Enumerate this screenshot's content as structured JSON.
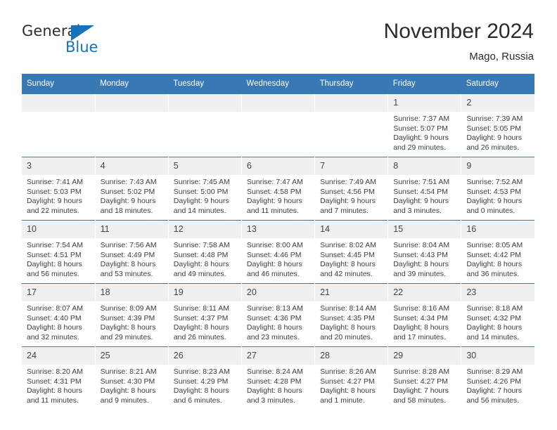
{
  "brand": {
    "name_part1": "General",
    "name_part2": "Blue",
    "accent_color": "#1672bb"
  },
  "header": {
    "title": "November 2024",
    "subtitle": "Mago, Russia"
  },
  "theme": {
    "header_bg": "#3878b5",
    "daynum_bg": "#f0f0f0",
    "text": "#3d3d3d"
  },
  "calendar": {
    "weekday_headers": [
      "Sunday",
      "Monday",
      "Tuesday",
      "Wednesday",
      "Thursday",
      "Friday",
      "Saturday"
    ],
    "weeks": [
      [
        {
          "day": "",
          "empty": true
        },
        {
          "day": "",
          "empty": true
        },
        {
          "day": "",
          "empty": true
        },
        {
          "day": "",
          "empty": true
        },
        {
          "day": "",
          "empty": true
        },
        {
          "day": "1",
          "sunrise": "Sunrise: 7:37 AM",
          "sunset": "Sunset: 5:07 PM",
          "daylight": "Daylight: 9 hours and 29 minutes."
        },
        {
          "day": "2",
          "sunrise": "Sunrise: 7:39 AM",
          "sunset": "Sunset: 5:05 PM",
          "daylight": "Daylight: 9 hours and 26 minutes."
        }
      ],
      [
        {
          "day": "3",
          "sunrise": "Sunrise: 7:41 AM",
          "sunset": "Sunset: 5:03 PM",
          "daylight": "Daylight: 9 hours and 22 minutes."
        },
        {
          "day": "4",
          "sunrise": "Sunrise: 7:43 AM",
          "sunset": "Sunset: 5:02 PM",
          "daylight": "Daylight: 9 hours and 18 minutes."
        },
        {
          "day": "5",
          "sunrise": "Sunrise: 7:45 AM",
          "sunset": "Sunset: 5:00 PM",
          "daylight": "Daylight: 9 hours and 14 minutes."
        },
        {
          "day": "6",
          "sunrise": "Sunrise: 7:47 AM",
          "sunset": "Sunset: 4:58 PM",
          "daylight": "Daylight: 9 hours and 11 minutes."
        },
        {
          "day": "7",
          "sunrise": "Sunrise: 7:49 AM",
          "sunset": "Sunset: 4:56 PM",
          "daylight": "Daylight: 9 hours and 7 minutes."
        },
        {
          "day": "8",
          "sunrise": "Sunrise: 7:51 AM",
          "sunset": "Sunset: 4:54 PM",
          "daylight": "Daylight: 9 hours and 3 minutes."
        },
        {
          "day": "9",
          "sunrise": "Sunrise: 7:52 AM",
          "sunset": "Sunset: 4:53 PM",
          "daylight": "Daylight: 9 hours and 0 minutes."
        }
      ],
      [
        {
          "day": "10",
          "sunrise": "Sunrise: 7:54 AM",
          "sunset": "Sunset: 4:51 PM",
          "daylight": "Daylight: 8 hours and 56 minutes."
        },
        {
          "day": "11",
          "sunrise": "Sunrise: 7:56 AM",
          "sunset": "Sunset: 4:49 PM",
          "daylight": "Daylight: 8 hours and 53 minutes."
        },
        {
          "day": "12",
          "sunrise": "Sunrise: 7:58 AM",
          "sunset": "Sunset: 4:48 PM",
          "daylight": "Daylight: 8 hours and 49 minutes."
        },
        {
          "day": "13",
          "sunrise": "Sunrise: 8:00 AM",
          "sunset": "Sunset: 4:46 PM",
          "daylight": "Daylight: 8 hours and 46 minutes."
        },
        {
          "day": "14",
          "sunrise": "Sunrise: 8:02 AM",
          "sunset": "Sunset: 4:45 PM",
          "daylight": "Daylight: 8 hours and 42 minutes."
        },
        {
          "day": "15",
          "sunrise": "Sunrise: 8:04 AM",
          "sunset": "Sunset: 4:43 PM",
          "daylight": "Daylight: 8 hours and 39 minutes."
        },
        {
          "day": "16",
          "sunrise": "Sunrise: 8:05 AM",
          "sunset": "Sunset: 4:42 PM",
          "daylight": "Daylight: 8 hours and 36 minutes."
        }
      ],
      [
        {
          "day": "17",
          "sunrise": "Sunrise: 8:07 AM",
          "sunset": "Sunset: 4:40 PM",
          "daylight": "Daylight: 8 hours and 32 minutes."
        },
        {
          "day": "18",
          "sunrise": "Sunrise: 8:09 AM",
          "sunset": "Sunset: 4:39 PM",
          "daylight": "Daylight: 8 hours and 29 minutes."
        },
        {
          "day": "19",
          "sunrise": "Sunrise: 8:11 AM",
          "sunset": "Sunset: 4:37 PM",
          "daylight": "Daylight: 8 hours and 26 minutes."
        },
        {
          "day": "20",
          "sunrise": "Sunrise: 8:13 AM",
          "sunset": "Sunset: 4:36 PM",
          "daylight": "Daylight: 8 hours and 23 minutes."
        },
        {
          "day": "21",
          "sunrise": "Sunrise: 8:14 AM",
          "sunset": "Sunset: 4:35 PM",
          "daylight": "Daylight: 8 hours and 20 minutes."
        },
        {
          "day": "22",
          "sunrise": "Sunrise: 8:16 AM",
          "sunset": "Sunset: 4:34 PM",
          "daylight": "Daylight: 8 hours and 17 minutes."
        },
        {
          "day": "23",
          "sunrise": "Sunrise: 8:18 AM",
          "sunset": "Sunset: 4:32 PM",
          "daylight": "Daylight: 8 hours and 14 minutes."
        }
      ],
      [
        {
          "day": "24",
          "sunrise": "Sunrise: 8:20 AM",
          "sunset": "Sunset: 4:31 PM",
          "daylight": "Daylight: 8 hours and 11 minutes."
        },
        {
          "day": "25",
          "sunrise": "Sunrise: 8:21 AM",
          "sunset": "Sunset: 4:30 PM",
          "daylight": "Daylight: 8 hours and 9 minutes."
        },
        {
          "day": "26",
          "sunrise": "Sunrise: 8:23 AM",
          "sunset": "Sunset: 4:29 PM",
          "daylight": "Daylight: 8 hours and 6 minutes."
        },
        {
          "day": "27",
          "sunrise": "Sunrise: 8:24 AM",
          "sunset": "Sunset: 4:28 PM",
          "daylight": "Daylight: 8 hours and 3 minutes."
        },
        {
          "day": "28",
          "sunrise": "Sunrise: 8:26 AM",
          "sunset": "Sunset: 4:27 PM",
          "daylight": "Daylight: 8 hours and 1 minute."
        },
        {
          "day": "29",
          "sunrise": "Sunrise: 8:28 AM",
          "sunset": "Sunset: 4:27 PM",
          "daylight": "Daylight: 7 hours and 58 minutes."
        },
        {
          "day": "30",
          "sunrise": "Sunrise: 8:29 AM",
          "sunset": "Sunset: 4:26 PM",
          "daylight": "Daylight: 7 hours and 56 minutes."
        }
      ]
    ]
  }
}
